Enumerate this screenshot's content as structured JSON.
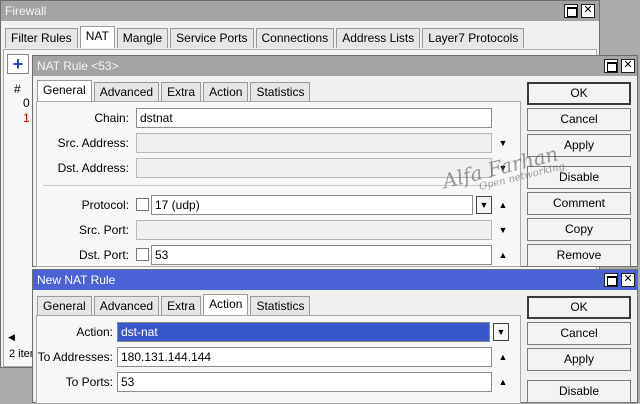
{
  "firewall": {
    "title": "Firewall",
    "tabs": [
      "Filter Rules",
      "NAT",
      "Mangle",
      "Service Ports",
      "Connections",
      "Address Lists",
      "Layer7 Protocols"
    ],
    "list_header": "#",
    "rows": [
      "0",
      "1"
    ],
    "status": "2 item"
  },
  "nat53": {
    "title": "NAT Rule <53>",
    "tabs": [
      "General",
      "Advanced",
      "Extra",
      "Action",
      "Statistics"
    ],
    "chain_label": "Chain:",
    "chain_value": "dstnat",
    "src_label": "Src. Address:",
    "dst_label": "Dst. Address:",
    "protocol_label": "Protocol:",
    "protocol_value": "17 (udp)",
    "srcport_label": "Src. Port:",
    "dstport_label": "Dst. Port:",
    "dstport_value": "53",
    "buttons": [
      "OK",
      "Cancel",
      "Apply",
      "Disable",
      "Comment",
      "Copy",
      "Remove"
    ]
  },
  "newnat": {
    "title": "New NAT Rule",
    "tabs": [
      "General",
      "Advanced",
      "Extra",
      "Action",
      "Statistics"
    ],
    "action_label": "Action:",
    "action_value": "dst-nat",
    "to_addr_label": "To Addresses:",
    "to_addr_value": "180.131.144.144",
    "to_ports_label": "To Ports:",
    "to_ports_value": "53",
    "buttons": [
      "OK",
      "Cancel",
      "Apply",
      "Disable"
    ]
  },
  "watermark": {
    "line1": "Alfa Farhan",
    "line2": "Open networking"
  },
  "colors": {
    "active_title": "#4b62d6",
    "inactive_title": "#a4a4a4",
    "selection": "#3a57c9",
    "row_red": "#cc0000"
  }
}
